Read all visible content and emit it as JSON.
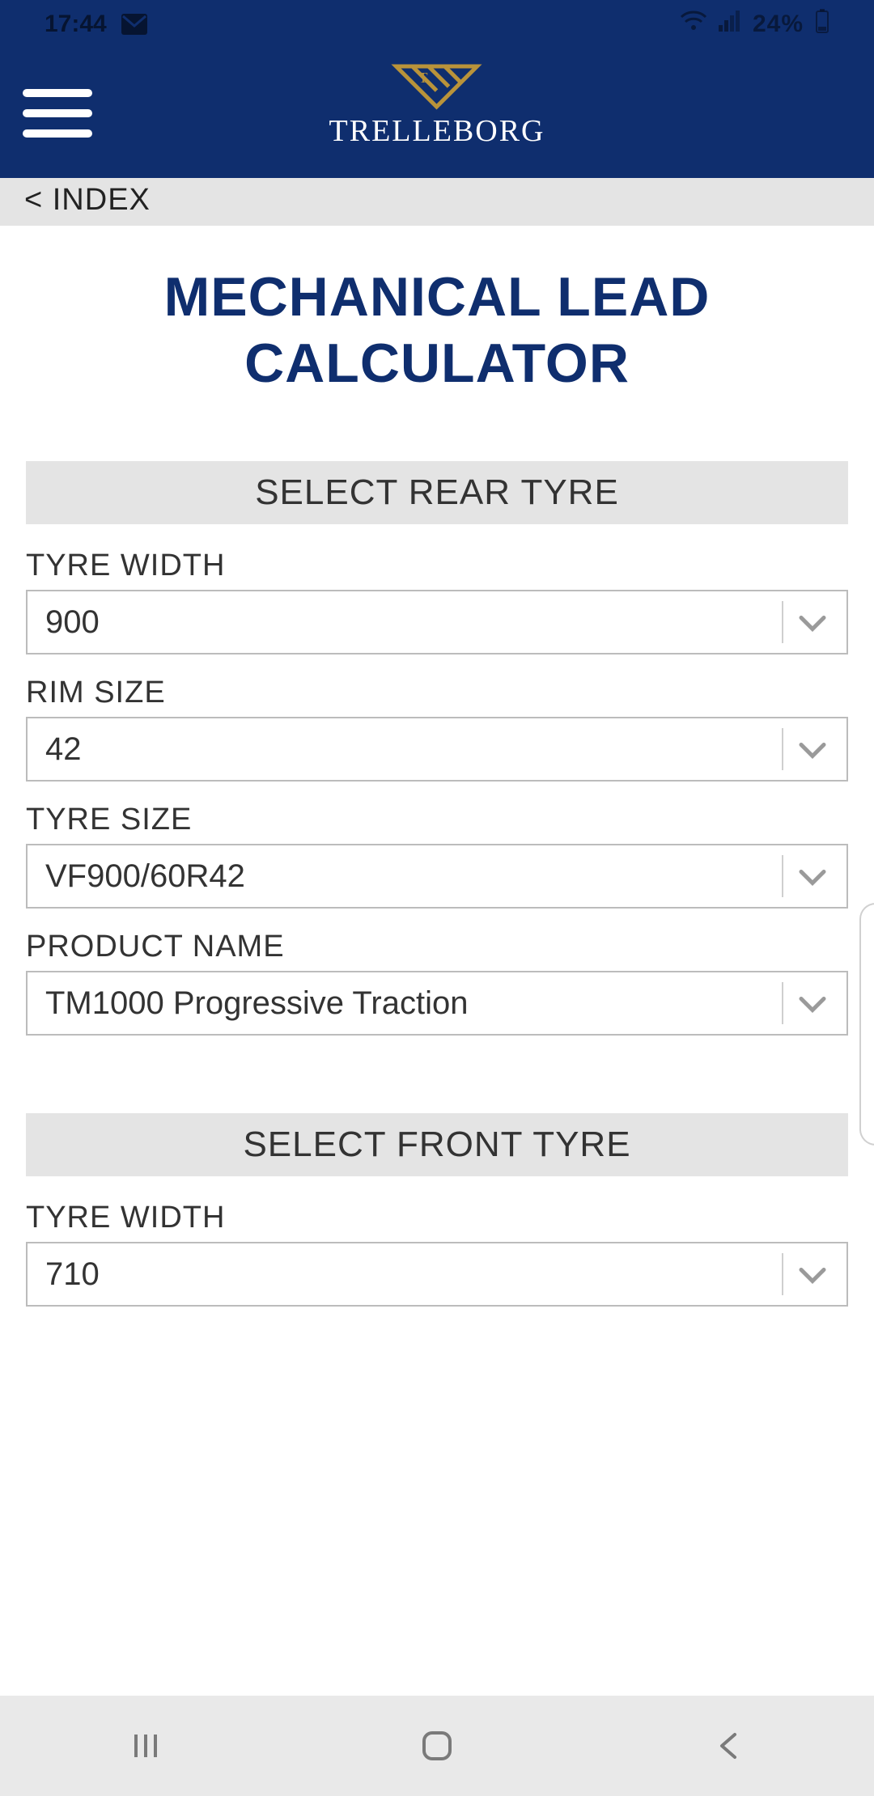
{
  "status": {
    "time": "17:44",
    "battery": "24%"
  },
  "header": {
    "brand": "TRELLEBORG"
  },
  "breadcrumb": {
    "index_link": "< INDEX"
  },
  "title": "MECHANICAL LEAD CALCULATOR",
  "rear": {
    "header": "SELECT REAR TYRE",
    "tyre_width": {
      "label": "TYRE WIDTH",
      "value": "900"
    },
    "rim_size": {
      "label": "RIM SIZE",
      "value": "42"
    },
    "tyre_size": {
      "label": "TYRE SIZE",
      "value": "VF900/60R42"
    },
    "product": {
      "label": "PRODUCT NAME",
      "value": "TM1000 Progressive Traction"
    }
  },
  "front": {
    "header": "SELECT FRONT TYRE",
    "tyre_width": {
      "label": "TYRE WIDTH",
      "value": "710"
    }
  }
}
